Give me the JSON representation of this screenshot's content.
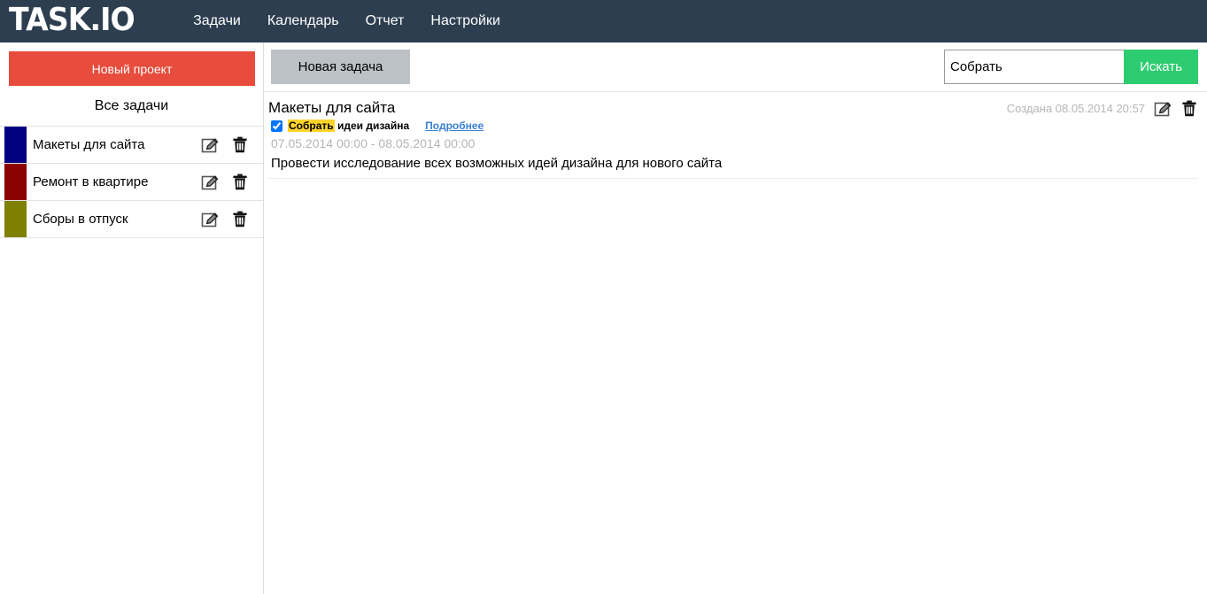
{
  "brand": {
    "logo": "TASK.IO"
  },
  "nav": {
    "items": [
      {
        "label": "Задачи"
      },
      {
        "label": "Календарь"
      },
      {
        "label": "Отчет"
      },
      {
        "label": "Настройки"
      }
    ]
  },
  "sidebar": {
    "new_project_label": "Новый проект",
    "all_tasks_label": "Все задачи",
    "projects": [
      {
        "name": "Макеты для сайта",
        "color": "#000080"
      },
      {
        "name": "Ремонт в квартире",
        "color": "#8b0000"
      },
      {
        "name": "Сборы в отпуск",
        "color": "#808000"
      }
    ],
    "edit_icon": "edit-pencil-icon",
    "delete_icon": "trash-icon"
  },
  "toolbar": {
    "new_task_label": "Новая задача",
    "search_value": "Собрать",
    "search_placeholder": "",
    "search_button_label": "Искать",
    "search_icon": "search-icon"
  },
  "task": {
    "project_title": "Макеты для сайта",
    "created_label": "Создана 08.05.2014 20:57",
    "checked": true,
    "text_highlight": "Собрать",
    "text_rest": " идеи дизайна",
    "details_label": "Подробнее",
    "dates": "07.05.2014 00:00 - 08.05.2014 00:00",
    "description": "Провести исследование всех возможных идей дизайна для нового сайта",
    "edit_icon": "edit-pencil-icon",
    "delete_icon": "trash-icon"
  },
  "colors": {
    "navbar": "#2d3e50",
    "accent_red": "#e74c3c",
    "accent_green": "#2ecc71",
    "button_gray": "#bcc1c6",
    "highlight_yellow": "#ffd42a",
    "link_blue": "#3a7fd5"
  }
}
